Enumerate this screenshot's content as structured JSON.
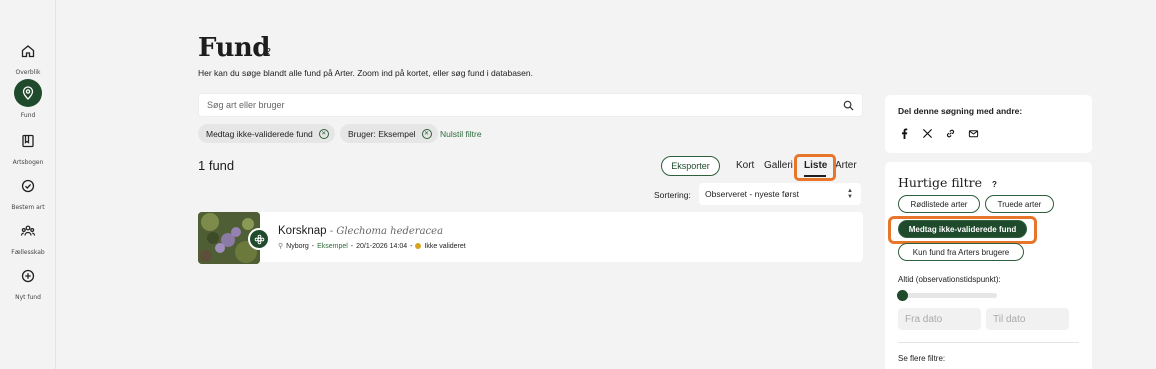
{
  "nav": [
    {
      "label": "Overblik",
      "icon": "home-icon"
    },
    {
      "label": "Fund",
      "icon": "location-pin-icon",
      "active": true
    },
    {
      "label": "Artsbogen",
      "icon": "book-icon"
    },
    {
      "label": "Bestem art",
      "icon": "check-circle-icon"
    },
    {
      "label": "Fællesskab",
      "icon": "community-icon"
    },
    {
      "label": "Nyt fund",
      "icon": "plus-circle-icon"
    }
  ],
  "page": {
    "title": "Fund",
    "help": "?",
    "subtitle": "Her kan du søge blandt alle fund på Arter. Zoom ind på kortet, eller søg fund i databasen."
  },
  "search": {
    "placeholder": "Søg art eller bruger"
  },
  "filters": {
    "chips": [
      "Medtag ikke-validerede fund",
      "Bruger: Eksempel"
    ],
    "reset_label": "Nulstil filtre"
  },
  "results": {
    "count": "1 fund",
    "export_label": "Eksporter",
    "tabs": [
      "Kort",
      "Galleri",
      "Liste",
      "Arter"
    ],
    "active_tab": "Liste",
    "sort_label": "Sortering:",
    "sort_value": "Observeret - nyeste først"
  },
  "finding": {
    "name": "Korsknap",
    "separator": " - ",
    "latin": "Glechoma hederacea",
    "location": "Nyborg",
    "user": "Eksempel",
    "date": "20/1-2026 14:04",
    "status": "Ikke valideret"
  },
  "share": {
    "title": "Del denne søgning med andre:",
    "icons": [
      "facebook-icon",
      "x-icon",
      "link-icon",
      "mail-icon"
    ]
  },
  "quick_filters": {
    "title": "Hurtige filtre",
    "help": "?",
    "pills": [
      "Rødlistede arter",
      "Truede arter",
      "Medtag ikke-validerede fund",
      "Kun fund fra Arters brugere"
    ],
    "active_pill": "Medtag ikke-validerede fund",
    "range_label": "Altid (observationstidspunkt):",
    "from_placeholder": "Fra dato",
    "to_placeholder": "Til dato",
    "more_label": "Se flere filtre:"
  },
  "colors": {
    "brand": "#1f4a2c",
    "highlight": "#e8762a",
    "warning": "#d9a320"
  }
}
